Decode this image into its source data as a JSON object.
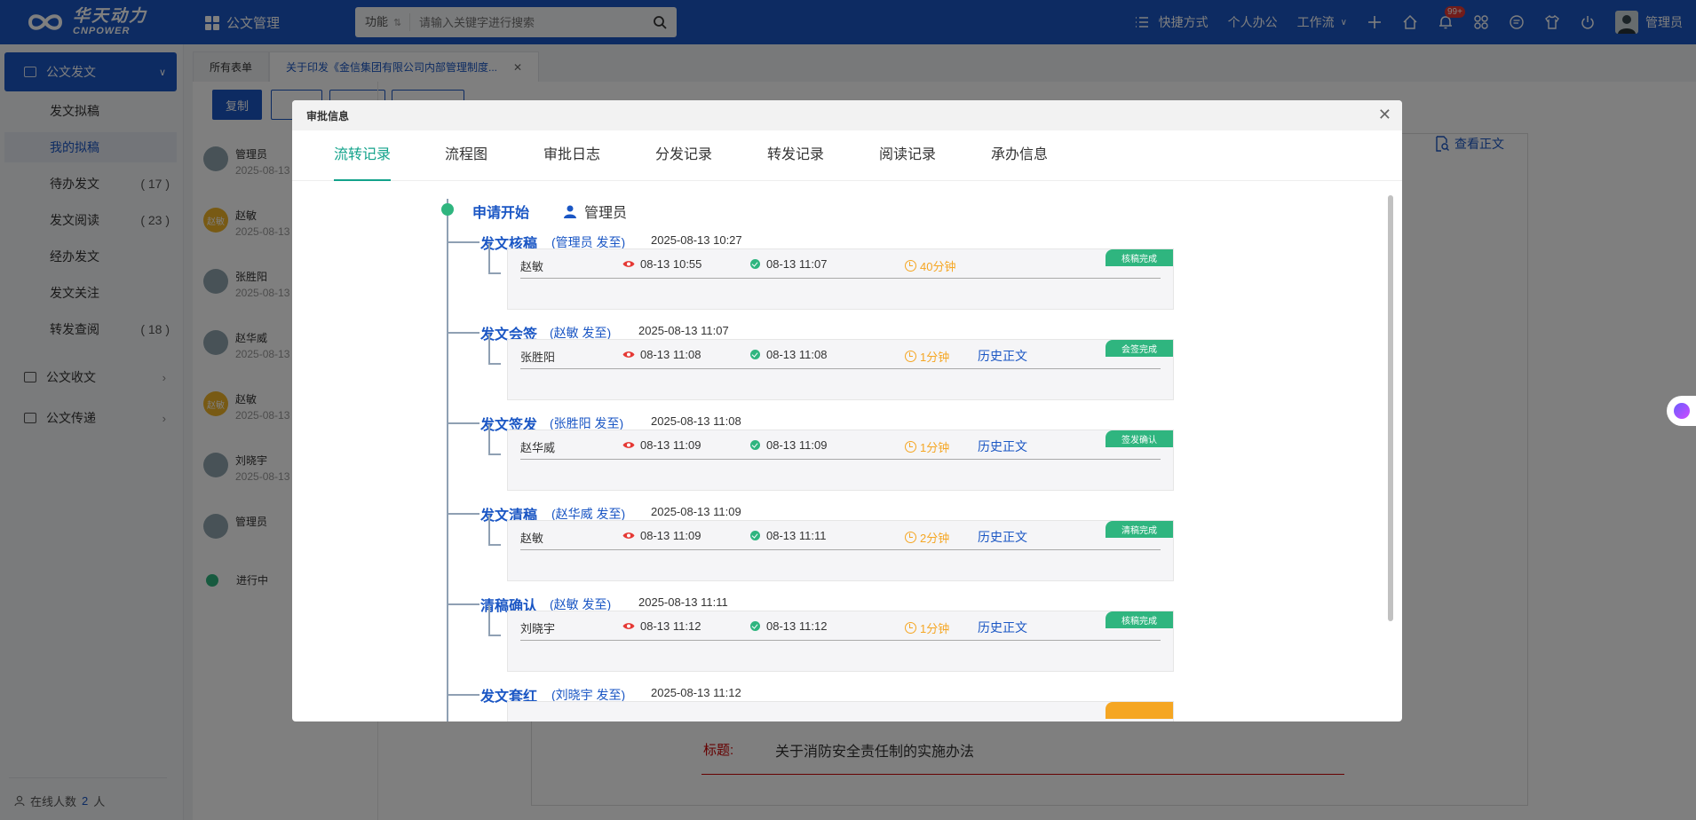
{
  "brand": {
    "name_cn": "华天动力",
    "name_en": "CNPOWER"
  },
  "header": {
    "app_menu": "公文管理",
    "search_func": "功能",
    "search_func_arrow": "⇅",
    "search_placeholder": "请输入关键字进行搜索",
    "shortcut": "快捷方式",
    "personal": "个人办公",
    "workflow": "工作流",
    "notification_badge": "99+",
    "user": "管理员"
  },
  "sidebar": {
    "active_group": "公文发文",
    "items": [
      {
        "label": "发文拟稿",
        "count": ""
      },
      {
        "label": "我的拟稿",
        "count": ""
      },
      {
        "label": "待办发文",
        "count": "( 17 )"
      },
      {
        "label": "发文阅读",
        "count": "( 23 )"
      },
      {
        "label": "经办发文",
        "count": ""
      },
      {
        "label": "发文关注",
        "count": ""
      },
      {
        "label": "转发查阅",
        "count": "( 18 )"
      }
    ],
    "groups": [
      "公文收文",
      "公文传递"
    ],
    "online_label": "在线人数",
    "online_count": "2",
    "online_unit": "人"
  },
  "content": {
    "tabs": [
      "所有表单",
      "关于印发《金信集团有限公司内部管理制度..."
    ],
    "copy_button": "复制",
    "flow_people": [
      {
        "name": "管理员",
        "date": "2025-08-13"
      },
      {
        "name": "赵敏",
        "date": "2025-08-13",
        "avatar_text": "赵敏"
      },
      {
        "name": "张胜阳",
        "date": "2025-08-13"
      },
      {
        "name": "赵华威",
        "date": "2025-08-13"
      },
      {
        "name": "赵敏",
        "date": "2025-08-13",
        "avatar_text": "赵敏"
      },
      {
        "name": "刘晓宇",
        "date": "2025-08-13"
      },
      {
        "name": "管理员",
        "date": ""
      }
    ],
    "in_progress": "进行中",
    "view_doc": "查看正文",
    "doc_title_label": "标题:",
    "doc_title_value": "关于消防安全责任制的实施办法"
  },
  "modal": {
    "title": "审批信息",
    "tabs": [
      "流转记录",
      "流程图",
      "审批日志",
      "分发记录",
      "转发记录",
      "阅读记录",
      "承办信息"
    ],
    "start_label": "申请开始",
    "start_user": "管理员",
    "steps": [
      {
        "name": "发文核稿",
        "sender": "(管理员 发至)",
        "time": "2025-08-13 10:27",
        "who": "赵敏",
        "viewed": "08-13 10:55",
        "done": "08-13 11:07",
        "duration": "40分钟",
        "history": "",
        "tag": "核稿完成"
      },
      {
        "name": "发文会签",
        "sender": "(赵敏 发至)",
        "time": "2025-08-13 11:07",
        "who": "张胜阳",
        "viewed": "08-13 11:08",
        "done": "08-13 11:08",
        "duration": "1分钟",
        "history": "历史正文",
        "tag": "会签完成"
      },
      {
        "name": "发文签发",
        "sender": "(张胜阳 发至)",
        "time": "2025-08-13 11:08",
        "who": "赵华威",
        "viewed": "08-13 11:09",
        "done": "08-13 11:09",
        "duration": "1分钟",
        "history": "历史正文",
        "tag": "签发确认"
      },
      {
        "name": "发文清稿",
        "sender": "(赵华威 发至)",
        "time": "2025-08-13 11:09",
        "who": "赵敏",
        "viewed": "08-13 11:09",
        "done": "08-13 11:11",
        "duration": "2分钟",
        "history": "历史正文",
        "tag": "清稿完成"
      },
      {
        "name": "清稿确认",
        "sender": "(赵敏 发至)",
        "time": "2025-08-13 11:11",
        "who": "刘晓宇",
        "viewed": "08-13 11:12",
        "done": "08-13 11:12",
        "duration": "1分钟",
        "history": "历史正文",
        "tag": "核稿完成"
      },
      {
        "name": "发文套红",
        "sender": "(刘晓宇 发至)",
        "time": "2025-08-13 11:12",
        "who": "",
        "viewed": "",
        "done": "",
        "duration": "",
        "history": "",
        "tag": ""
      }
    ]
  },
  "colors": {
    "primary": "#1a56c4",
    "tab_active": "#13a38b",
    "success": "#2fb57f",
    "warning": "#f5a623"
  }
}
